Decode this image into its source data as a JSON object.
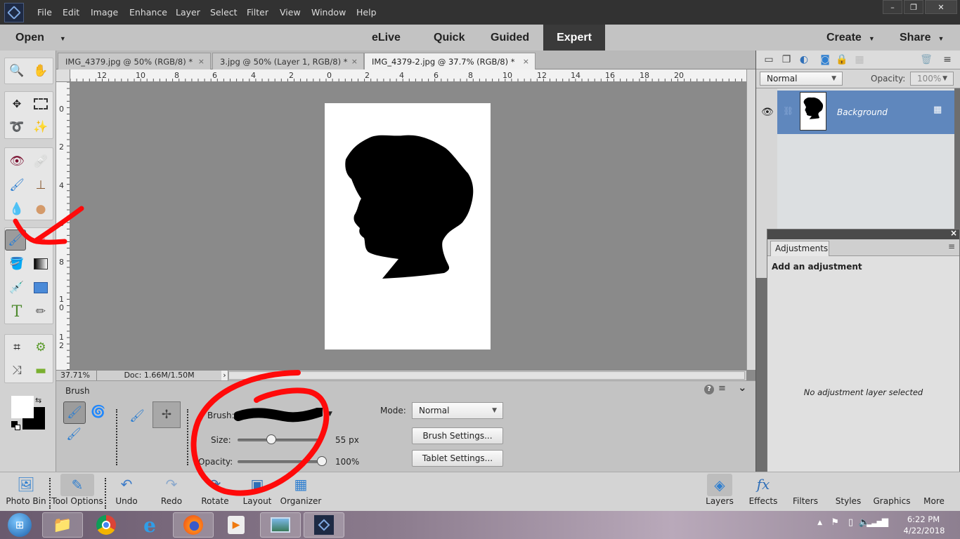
{
  "app": {
    "menu": [
      "File",
      "Edit",
      "Image",
      "Enhance",
      "Layer",
      "Select",
      "Filter",
      "View",
      "Window",
      "Help"
    ],
    "window_controls": {
      "minimize": "–",
      "restore": "❐",
      "close": "✕"
    }
  },
  "modebar": {
    "open_label": "Open",
    "modes": [
      "eLive",
      "Quick",
      "Guided",
      "Expert"
    ],
    "active_mode": "Expert",
    "create_label": "Create",
    "share_label": "Share"
  },
  "doc_tabs": [
    {
      "label": "IMG_4379.jpg @ 50% (RGB/8) *",
      "close": "×",
      "active": false
    },
    {
      "label": "3.jpg @ 50% (Layer 1, RGB/8) *",
      "close": "×",
      "active": false
    },
    {
      "label": "IMG_4379-2.jpg @ 37.7% (RGB/8) *",
      "close": "×",
      "active": true
    }
  ],
  "ruler": {
    "horizontal_labels": [
      "12",
      "10",
      "8",
      "6",
      "4",
      "2",
      "0",
      "2",
      "4",
      "6",
      "8",
      "10",
      "12",
      "14",
      "16",
      "18",
      "20"
    ],
    "vertical_labels": [
      "0",
      "2",
      "4",
      "6",
      "8",
      "10",
      "12"
    ]
  },
  "statusbar": {
    "zoom": "37.71%",
    "doc_size": "Doc: 1.66M/1.50M",
    "arrow": "›"
  },
  "tool_options": {
    "title": "Brush",
    "brush_label": "Brush:",
    "size_label": "Size:",
    "size_value": "55 px",
    "size_fraction": 0.4,
    "opacity_label": "Opacity:",
    "opacity_value": "100%",
    "opacity_fraction": 1.0,
    "mode_label": "Mode:",
    "mode_value": "Normal",
    "brush_settings_label": "Brush Settings...",
    "tablet_settings_label": "Tablet Settings...",
    "help_icon": "?",
    "menu_icon": "≡",
    "collapse_icon": "⌄"
  },
  "layers_panel": {
    "blend_mode": "Normal",
    "opacity_label": "Opacity:",
    "opacity_value": "100%",
    "layers": [
      {
        "name": "Background",
        "visible": true,
        "locked": true
      }
    ]
  },
  "adjustments_panel": {
    "tab_label": "Adjustments",
    "heading": "Add an adjustment",
    "empty_message": "No adjustment layer selected",
    "close": "×"
  },
  "bottom_bar": {
    "left": [
      {
        "label": "Photo Bin",
        "icon": "photo-bin-icon"
      },
      {
        "label": "Tool Options",
        "icon": "tool-options-icon",
        "active": true
      },
      {
        "label": "Undo",
        "icon": "undo-icon"
      },
      {
        "label": "Redo",
        "icon": "redo-icon"
      },
      {
        "label": "Rotate",
        "icon": "rotate-icon"
      },
      {
        "label": "Layout",
        "icon": "layout-icon"
      },
      {
        "label": "Organizer",
        "icon": "organizer-icon"
      }
    ],
    "right": [
      {
        "label": "Layers",
        "icon": "layers-icon",
        "active": true
      },
      {
        "label": "Effects",
        "icon": "effects-icon"
      },
      {
        "label": "Filters",
        "icon": "filters-icon"
      },
      {
        "label": "Styles",
        "icon": "styles-icon"
      },
      {
        "label": "Graphics",
        "icon": "graphics-icon"
      },
      {
        "label": "More",
        "icon": "more-icon"
      }
    ]
  },
  "taskbar": {
    "apps": [
      "Start",
      "File Explorer",
      "Chrome",
      "Internet Explorer",
      "Firefox",
      "Media Player",
      "Photos",
      "Photoshop Elements"
    ],
    "time": "6:22 PM",
    "date": "4/22/2018"
  },
  "colors": {
    "accent_layer_selected": "#5f87bd",
    "annotation_red": "#ff0a0a",
    "expert_tab_bg": "#3a3a3a"
  }
}
